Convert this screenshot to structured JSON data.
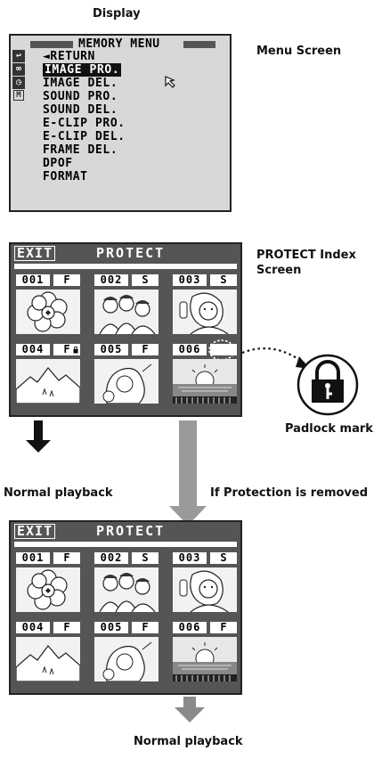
{
  "captions": {
    "display": "Display",
    "menu_screen": "Menu Screen",
    "protect_index_line1": "PROTECT Index",
    "protect_index_line2": "Screen",
    "padlock_mark": "Padlock mark",
    "normal_playback_left": "Normal playback",
    "if_protection_removed": "If Protection is removed",
    "normal_playback_bottom": "Normal playback"
  },
  "menu": {
    "title": "MEMORY MENU",
    "items": [
      "◄RETURN",
      "IMAGE PRO.",
      "IMAGE DEL.",
      "SOUND PRO.",
      "SOUND DEL.",
      "E-CLIP PRO.",
      "E-CLIP DEL.",
      "FRAME DEL.",
      "DPOF",
      "FORMAT"
    ],
    "selected_index": 1,
    "side_icons": [
      "return-icon",
      "camera-icon",
      "clock-icon",
      "memory-card-icon"
    ],
    "side_glyphs": [
      "↩",
      "∞",
      "◷",
      "M"
    ]
  },
  "protect_top": {
    "exit": "EXIT",
    "title": "PROTECT",
    "tiles": [
      {
        "num": "001",
        "type": "F",
        "image": "flower"
      },
      {
        "num": "002",
        "type": "S",
        "image": "group-people"
      },
      {
        "num": "003",
        "type": "S",
        "image": "woman-phone"
      },
      {
        "num": "004",
        "type": "F",
        "image": "mountain",
        "padlock": true
      },
      {
        "num": "005",
        "type": "F",
        "image": "girl-portrait"
      },
      {
        "num": "006",
        "type": "",
        "image": "sunset-sea",
        "circled": true
      }
    ]
  },
  "protect_bottom": {
    "exit": "EXIT",
    "title": "PROTECT",
    "tiles": [
      {
        "num": "001",
        "type": "F",
        "image": "flower"
      },
      {
        "num": "002",
        "type": "S",
        "image": "group-people"
      },
      {
        "num": "003",
        "type": "S",
        "image": "woman-phone"
      },
      {
        "num": "004",
        "type": "F",
        "image": "mountain"
      },
      {
        "num": "005",
        "type": "F",
        "image": "girl-portrait"
      },
      {
        "num": "006",
        "type": "F",
        "image": "sunset-sea"
      }
    ]
  }
}
